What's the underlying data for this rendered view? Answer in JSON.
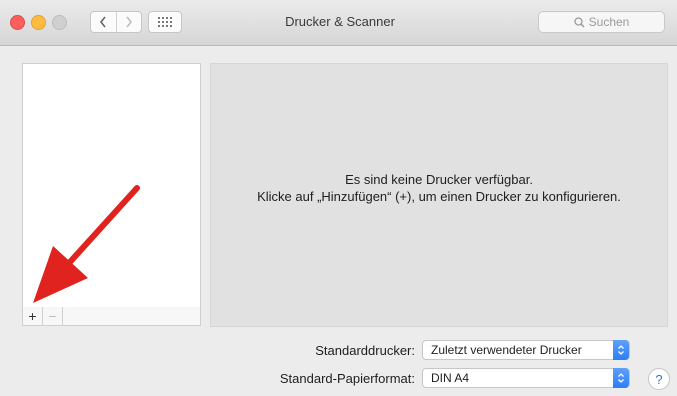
{
  "window": {
    "title": "Drucker & Scanner",
    "search_placeholder": "Suchen"
  },
  "nav": {
    "back_icon": "chevron-left-icon",
    "forward_icon": "chevron-right-icon",
    "grid_icon": "grid-icon"
  },
  "list_toolbar": {
    "add_label": "+",
    "remove_label": "−"
  },
  "detail": {
    "empty_line1": "Es sind keine Drucker verfügbar.",
    "empty_line2": "Klicke auf „Hinzufügen“ (+), um einen Drucker zu konfigurieren."
  },
  "form": {
    "default_printer_label": "Standarddrucker:",
    "default_printer_value": "Zuletzt verwendeter Drucker",
    "paper_format_label": "Standard-Papierformat:",
    "paper_format_value": "DIN A4"
  },
  "help_label": "?",
  "colors": {
    "accent": "#2c7ef5",
    "annotation_arrow": "#e0231f"
  }
}
